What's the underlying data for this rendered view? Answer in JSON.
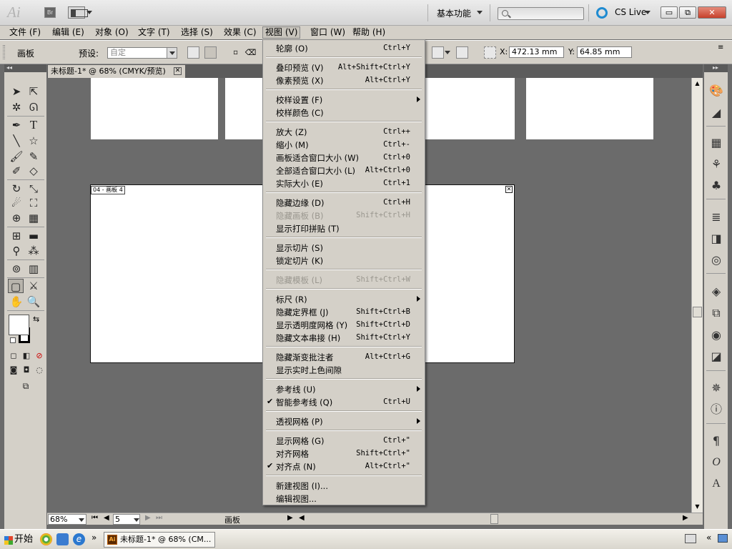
{
  "titlebar": {
    "app_logo": "Ai",
    "bridge_label": "Br",
    "workspace": "基本功能",
    "search_placeholder": "",
    "cs_live": "CS Live",
    "minimize_glyph": "▭",
    "restore_glyph": "⧉",
    "close_glyph": "✕"
  },
  "menubar": [
    "文件 (F)",
    "编辑 (E)",
    "对象 (O)",
    "文字 (T)",
    "选择 (S)",
    "效果 (C)",
    "视图 (V)",
    "窗口 (W)",
    "帮助 (H)"
  ],
  "menubar_open_index": 6,
  "control_panel": {
    "artboard_label": "画板",
    "preset_label": "预设:",
    "preset_value": "自定",
    "x_label": "X:",
    "x_value": "472.13 mm",
    "y_label": "Y:",
    "y_value": "64.85 mm"
  },
  "document": {
    "tab_title": "未标题-1* @ 68% (CMYK/预览)",
    "tab_close": "✕",
    "artboard_label": "04 - 画板 4",
    "artboard_close": "✕"
  },
  "statusbar": {
    "zoom": "68%",
    "page": "5",
    "tool_name": "画板"
  },
  "view_menu": {
    "items": [
      {
        "type": "item",
        "label": "轮廓 (O)",
        "shortcut": "Ctrl+Y"
      },
      {
        "type": "sep"
      },
      {
        "type": "item",
        "label": "叠印预览 (V)",
        "shortcut": "Alt+Shift+Ctrl+Y"
      },
      {
        "type": "item",
        "label": "像素预览 (X)",
        "shortcut": "Alt+Ctrl+Y"
      },
      {
        "type": "sep"
      },
      {
        "type": "item",
        "label": "校样设置 (F)",
        "shortcut": "",
        "submenu": true
      },
      {
        "type": "item",
        "label": "校样颜色 (C)",
        "shortcut": ""
      },
      {
        "type": "sep"
      },
      {
        "type": "item",
        "label": "放大 (Z)",
        "shortcut": "Ctrl++"
      },
      {
        "type": "item",
        "label": "缩小 (M)",
        "shortcut": "Ctrl+-"
      },
      {
        "type": "item",
        "label": "画板适合窗口大小 (W)",
        "shortcut": "Ctrl+0"
      },
      {
        "type": "item",
        "label": "全部适合窗口大小 (L)",
        "shortcut": "Alt+Ctrl+0"
      },
      {
        "type": "item",
        "label": "实际大小 (E)",
        "shortcut": "Ctrl+1"
      },
      {
        "type": "sep"
      },
      {
        "type": "item",
        "label": "隐藏边缘 (D)",
        "shortcut": "Ctrl+H"
      },
      {
        "type": "item",
        "label": "隐藏画板 (B)",
        "shortcut": "Shift+Ctrl+H",
        "disabled": true
      },
      {
        "type": "item",
        "label": "显示打印拼贴 (T)",
        "shortcut": ""
      },
      {
        "type": "sep"
      },
      {
        "type": "item",
        "label": "显示切片 (S)",
        "shortcut": ""
      },
      {
        "type": "item",
        "label": "锁定切片 (K)",
        "shortcut": ""
      },
      {
        "type": "sep"
      },
      {
        "type": "item",
        "label": "隐藏模板 (L)",
        "shortcut": "Shift+Ctrl+W",
        "disabled": true
      },
      {
        "type": "sep"
      },
      {
        "type": "item",
        "label": "标尺 (R)",
        "shortcut": "",
        "submenu": true
      },
      {
        "type": "item",
        "label": "隐藏定界框 (J)",
        "shortcut": "Shift+Ctrl+B"
      },
      {
        "type": "item",
        "label": "显示透明度网格 (Y)",
        "shortcut": "Shift+Ctrl+D"
      },
      {
        "type": "item",
        "label": "隐藏文本串接 (H)",
        "shortcut": "Shift+Ctrl+Y"
      },
      {
        "type": "sep"
      },
      {
        "type": "item",
        "label": "隐藏渐变批注者",
        "shortcut": "Alt+Ctrl+G"
      },
      {
        "type": "item",
        "label": "显示实时上色间隙",
        "shortcut": ""
      },
      {
        "type": "sep"
      },
      {
        "type": "item",
        "label": "参考线 (U)",
        "shortcut": "",
        "submenu": true
      },
      {
        "type": "item",
        "label": "智能参考线 (Q)",
        "shortcut": "Ctrl+U",
        "checked": true
      },
      {
        "type": "sep"
      },
      {
        "type": "item",
        "label": "透视网格 (P)",
        "shortcut": "",
        "submenu": true
      },
      {
        "type": "sep"
      },
      {
        "type": "item",
        "label": "显示网格 (G)",
        "shortcut": "Ctrl+\""
      },
      {
        "type": "item",
        "label": "对齐网格",
        "shortcut": "Shift+Ctrl+\""
      },
      {
        "type": "item",
        "label": "对齐点 (N)",
        "shortcut": "Alt+Ctrl+\"",
        "checked": true
      },
      {
        "type": "sep"
      },
      {
        "type": "item",
        "label": "新建视图 (I)...",
        "shortcut": ""
      },
      {
        "type": "item",
        "label": "编辑视图...",
        "shortcut": ""
      }
    ]
  },
  "taskbar": {
    "start_label": "开始",
    "task_label": "未标题-1* @ 68% (CM...",
    "overflow": "»",
    "tray_overflow": "«"
  },
  "icons": {
    "tools": [
      "selection-icon",
      "direct-selection-icon",
      "magic-wand-icon",
      "lasso-icon",
      "pen-icon",
      "type-icon",
      "line-icon",
      "star-icon",
      "paintbrush-icon",
      "pencil-icon",
      "blob-brush-icon",
      "eraser-icon",
      "rotate-icon",
      "scale-icon",
      "warp-icon",
      "free-transform-icon",
      "shape-builder-icon",
      "perspective-grid-icon",
      "mesh-icon",
      "gradient-icon",
      "eyedropper-icon",
      "blend-icon",
      "symbol-sprayer-icon",
      "column-graph-icon",
      "artboard-icon",
      "slice-icon",
      "hand-icon",
      "zoom-icon"
    ],
    "dock": [
      "color-icon",
      "color-guide-icon",
      "swatches-icon",
      "brushes-icon",
      "symbols-icon",
      "stroke-icon",
      "gradient-panel-icon",
      "transparency-icon",
      "layers-icon",
      "artboards-panel-icon",
      "appearance-icon",
      "graphic-styles-icon",
      "navigator-icon",
      "info-icon",
      "paragraph-icon",
      "opentype-icon",
      "character-icon"
    ]
  }
}
